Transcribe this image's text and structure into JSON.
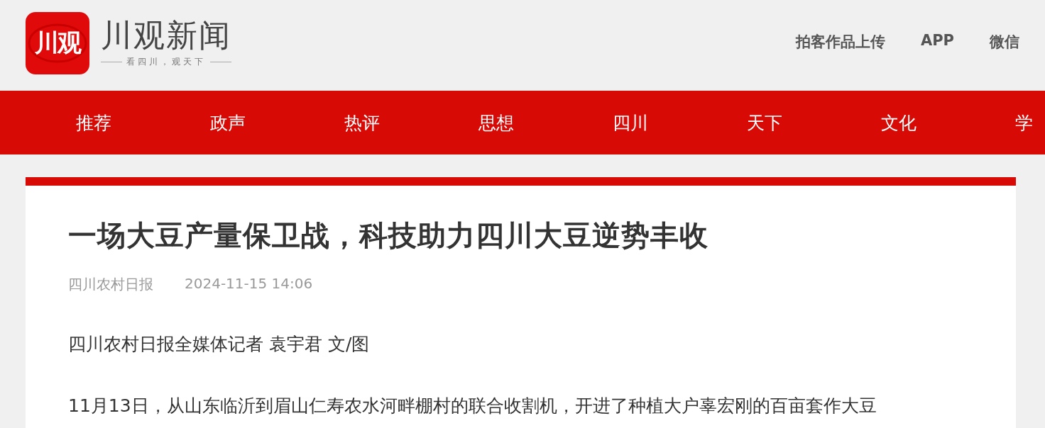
{
  "logo": {
    "mark": "川观",
    "name": "川观新闻",
    "slogan": "看四川，观天下"
  },
  "header_links": [
    "拍客作品上传",
    "APP",
    "微信"
  ],
  "nav": [
    "推荐",
    "政声",
    "热评",
    "思想",
    "四川",
    "天下",
    "文化",
    "学"
  ],
  "article": {
    "title": "一场大豆产量保卫战，科技助力四川大豆逆势丰收",
    "source": "四川农村日报",
    "time": "2024-11-15 14:06",
    "byline": "四川农村日报全媒体记者 袁宇君 文/图",
    "paragraphs": [
      "11月13日，从山东临沂到眉山仁寿农水河畔棚村的联合收割机，开进了种植大户辜宏刚的百亩套作大豆"
    ]
  }
}
